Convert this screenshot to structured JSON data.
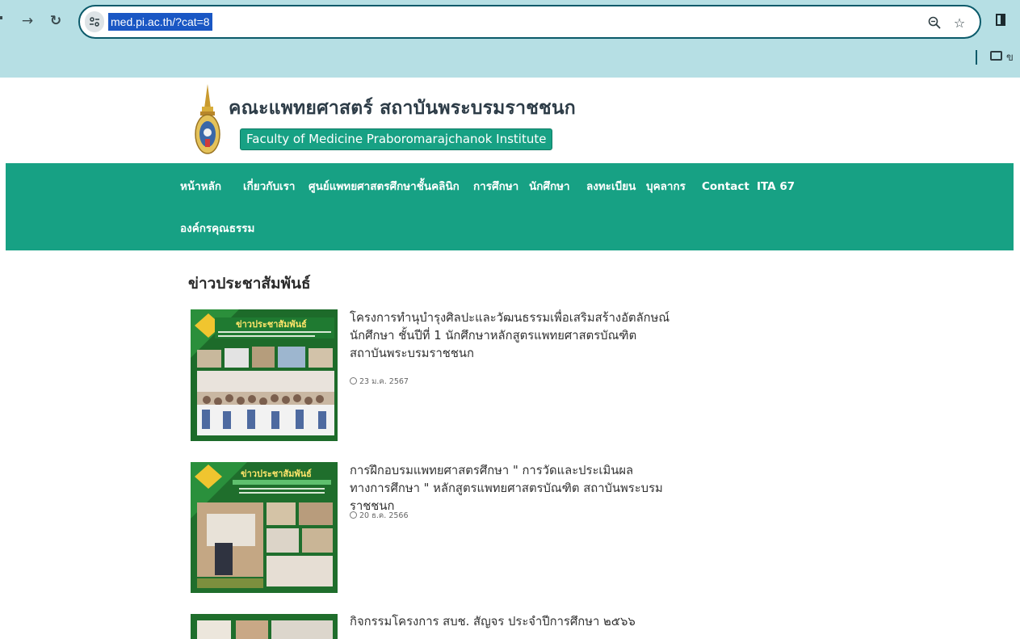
{
  "browser": {
    "url": "med.pi.ac.th/?cat=8",
    "bookmarks_label": "ข"
  },
  "site": {
    "title": "คณะแพทยศาสตร์ สถาบันพระบรมราชชนก",
    "subtitle": "Faculty of Medicine Praboromarajchanok Institute"
  },
  "nav": {
    "items": [
      "หน้าหลัก",
      "เกี่ยวกับเรา",
      "ศูนย์แพทยศาสตรศึกษาชั้นคลินิก",
      "การศึกษา",
      "นักศึกษา",
      "ลงทะเบียน",
      "บุคลากร",
      "Contact",
      "ITA 67",
      "องค์กรคุณธรรม"
    ]
  },
  "content": {
    "section_title": "ข่าวประชาสัมพันธ์",
    "posts": [
      {
        "title": "โครงการทำนุบำรุงศิลปะและวัฒนธรรมเพื่อเสริมสร้างอัตลักษณ์ นักศึกษา ชั้นปีที่ 1 นักศึกษาหลักสูตรแพทยศาสตรบัณฑิต สถาบันพระบรมราชชนก",
        "date": "23 ม.ค. 2567",
        "thumb_caption": "ข่าวประชาสัมพันธ์"
      },
      {
        "title": "การฝึกอบรมแพทยศาสตรศึกษา \" การวัดและประเมินผลทางการศึกษา \" หลักสูตรแพทยศาสตรบัณฑิต สถาบันพระบรมราชชนก",
        "date": "20 ธ.ค. 2566",
        "thumb_caption": "ข่าวประชาสัมพันธ์"
      },
      {
        "title": "กิจกรรมโครงการ สบช. สัญจร ประจำปีการศึกษา ๒๕๖๖"
      }
    ]
  },
  "colors": {
    "brand_green": "#17a184",
    "chrome_bg": "#b6dfe4",
    "url_highlight": "#1a57c4"
  }
}
